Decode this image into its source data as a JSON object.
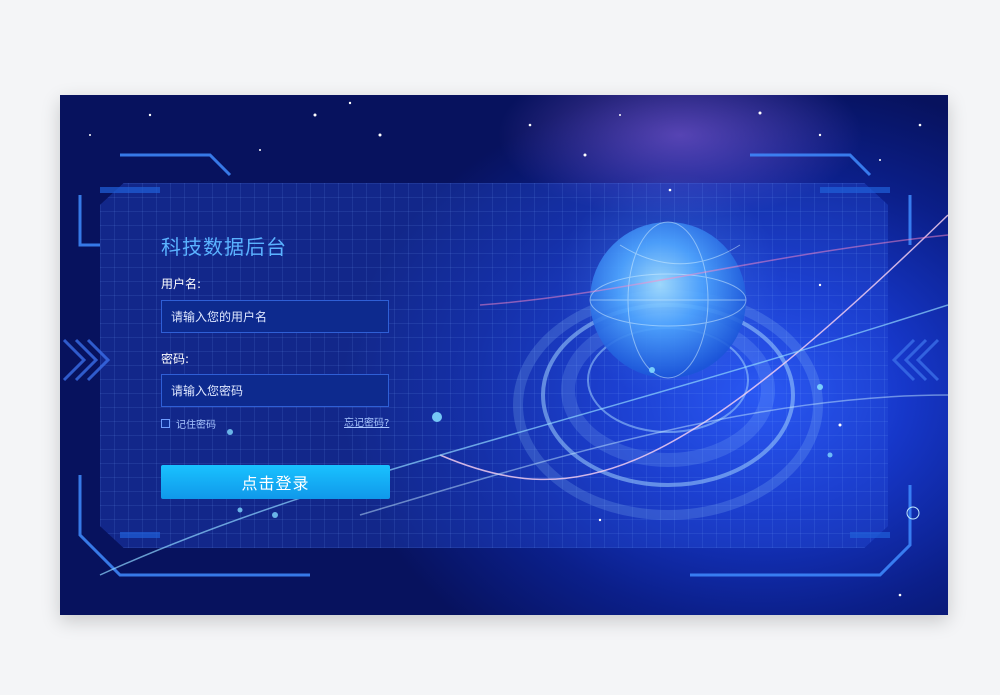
{
  "login": {
    "title": "科技数据后台",
    "username_label": "用户名:",
    "username_placeholder": "请输入您的用户名",
    "password_label": "密码:",
    "password_placeholder": "请输入您密码",
    "remember_label": "记住密码",
    "forgot_link": "忘记密码?",
    "submit_label": "点击登录"
  },
  "colors": {
    "title": "#5ab2ff",
    "button": "#19c2ff",
    "background_deep": "#07125e",
    "background_mid": "#1637c9"
  }
}
